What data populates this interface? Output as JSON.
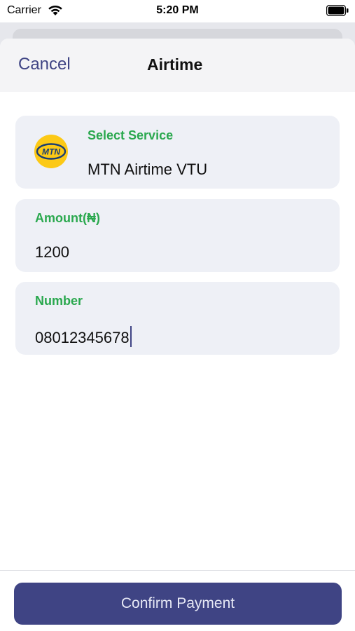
{
  "status_bar": {
    "carrier": "Carrier",
    "time": "5:20 PM"
  },
  "nav": {
    "cancel_label": "Cancel",
    "title": "Airtime"
  },
  "service": {
    "label": "Select Service",
    "value": "MTN Airtime VTU",
    "logo_text": "MTN",
    "logo_icon": "mtn-logo-icon"
  },
  "amount": {
    "label": "Amount(₦)",
    "value": "1200"
  },
  "number": {
    "label": "Number",
    "value": "08012345678"
  },
  "actions": {
    "confirm_label": "Confirm Payment"
  },
  "colors": {
    "accent": "#3f4484",
    "label_green": "#2aa84e",
    "card_bg": "#eef0f6",
    "mtn_yellow": "#fcc916"
  }
}
